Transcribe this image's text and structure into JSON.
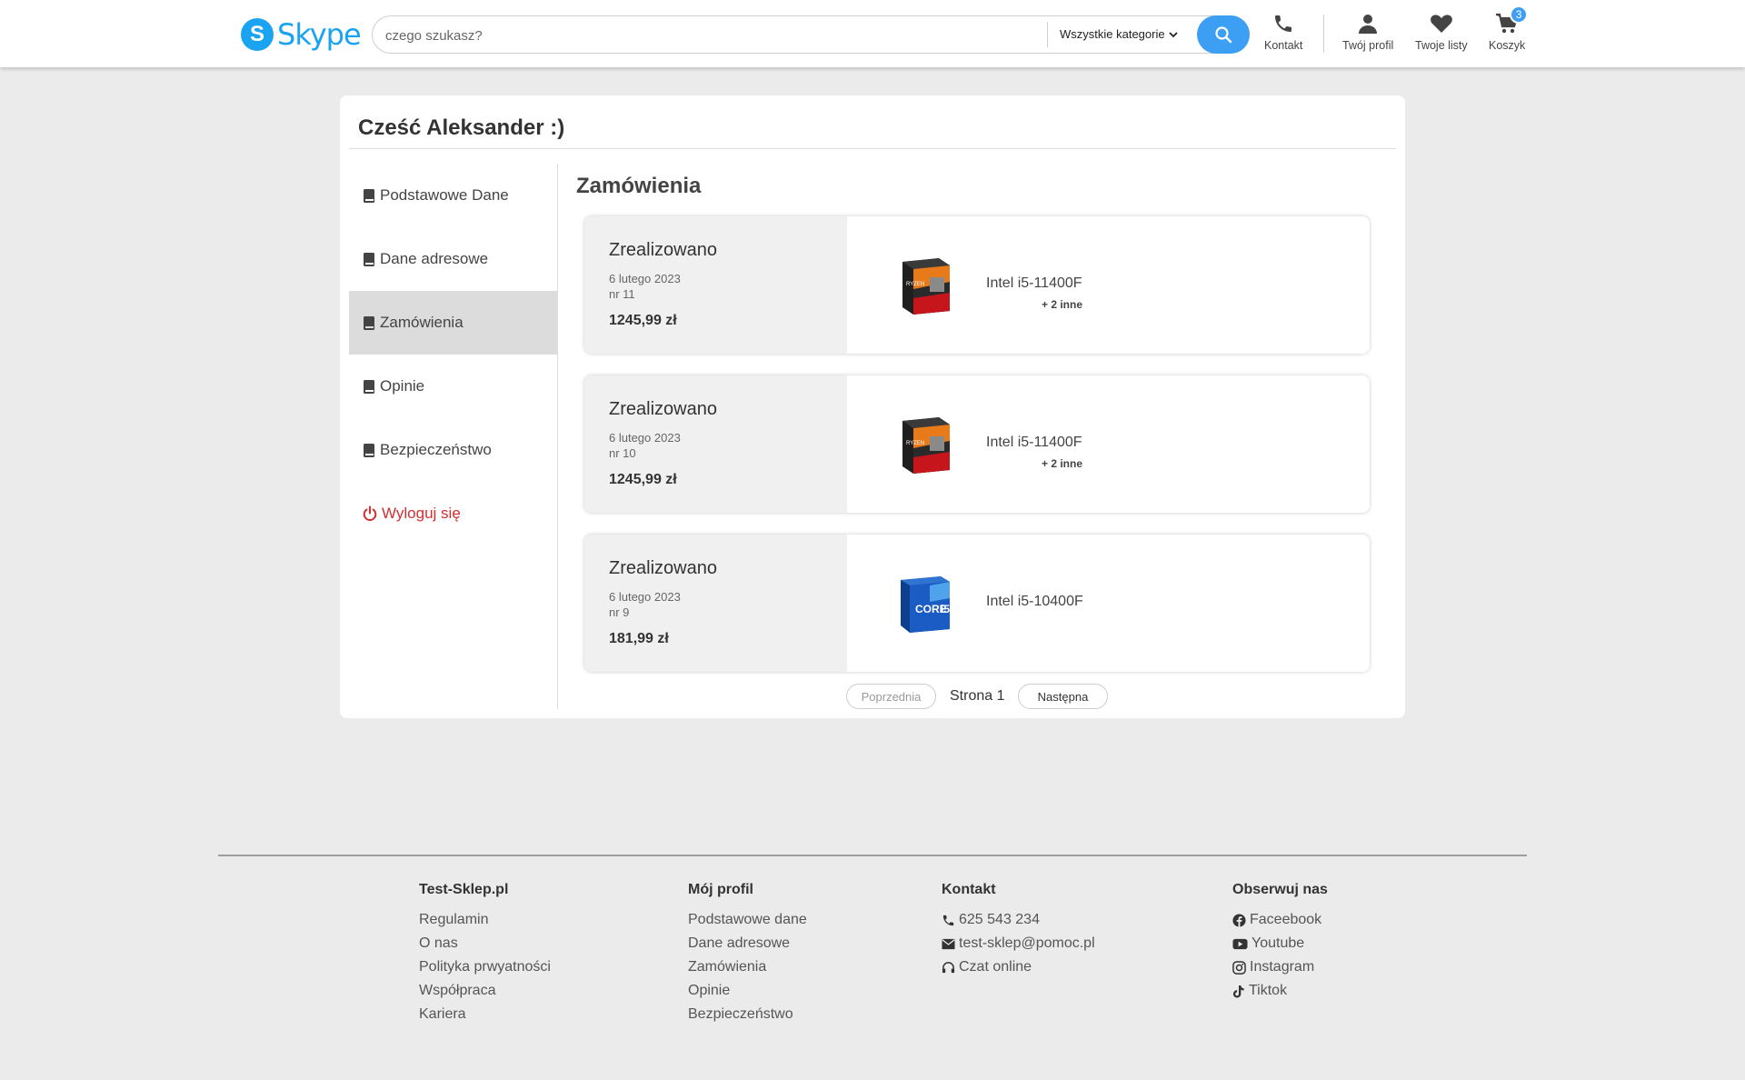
{
  "header": {
    "logo_letter": "S",
    "logo_text": "Skype",
    "search_placeholder": "czego szukasz?",
    "category_label": "Wszystkie kategorie",
    "contact_label": "Kontakt",
    "profile_label": "Twój profil",
    "lists_label": "Twoje listy",
    "cart_label": "Koszyk",
    "cart_count": "3"
  },
  "account": {
    "greeting": "Cześć Aleksander :)",
    "sidebar": [
      {
        "label": "Podstawowe Dane",
        "icon": "book-icon"
      },
      {
        "label": "Dane adresowe",
        "icon": "book-icon"
      },
      {
        "label": "Zamówienia",
        "icon": "book-icon",
        "active": true
      },
      {
        "label": "Opinie",
        "icon": "book-icon"
      },
      {
        "label": "Bezpieczeństwo",
        "icon": "book-icon"
      },
      {
        "label": "Wyloguj się",
        "icon": "power-icon"
      }
    ]
  },
  "orders": {
    "title": "Zamówienia",
    "items": [
      {
        "status": "Zrealizowano",
        "date": "6 lutego 2023",
        "number": "nr 11",
        "total": "1245,99 zł",
        "product": "Intel i5-11400F",
        "more": "+ 2 inne",
        "thumb": "ryzen-box"
      },
      {
        "status": "Zrealizowano",
        "date": "6 lutego 2023",
        "number": "nr 10",
        "total": "1245,99 zł",
        "product": "Intel i5-11400F",
        "more": "+ 2 inne",
        "thumb": "ryzen-box"
      },
      {
        "status": "Zrealizowano",
        "date": "6 lutego 2023",
        "number": "nr 9",
        "total": "181,99 zł",
        "product": "Intel i5-10400F",
        "more": "",
        "thumb": "intel-box"
      }
    ],
    "pagination": {
      "prev": "Poprzednia",
      "page": "Strona 1",
      "next": "Następna"
    }
  },
  "footer": {
    "col1": {
      "title": "Test-Sklep.pl",
      "links": [
        "Regulamin",
        "O nas",
        "Polityka prwyatności",
        "Współpraca",
        "Kariera"
      ]
    },
    "col2": {
      "title": "Mój profil",
      "links": [
        "Podstawowe dane",
        "Dane adresowe",
        "Zamówienia",
        "Opinie",
        "Bezpieczeństwo"
      ]
    },
    "col3": {
      "title": "Kontakt",
      "links": [
        "625 543 234",
        "test-sklep@pomoc.pl",
        "Czat online"
      ]
    },
    "col4": {
      "title": "Obserwuj nas",
      "links": [
        "Faceebook",
        "Youtube",
        "Instagram",
        "Tiktok"
      ]
    }
  },
  "colors": {
    "accent": "#3d9ff3",
    "logo": "#1aa3f0",
    "logout": "#d32f2f",
    "background": "#ebebeb"
  }
}
